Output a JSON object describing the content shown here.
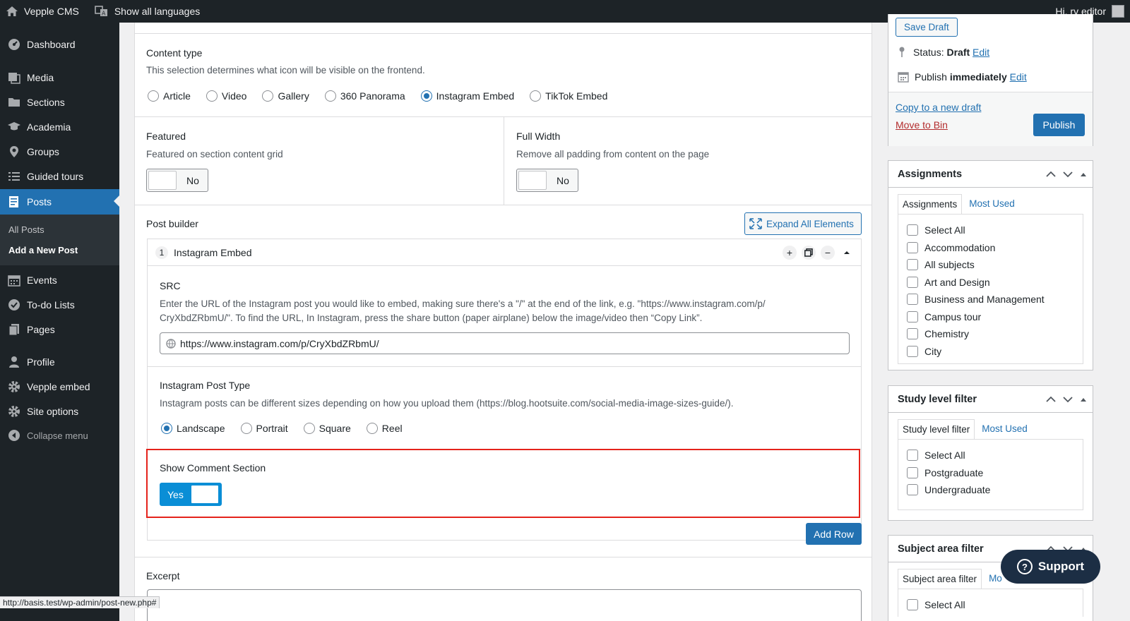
{
  "adminbar": {
    "site_name": "Vepple CMS",
    "languages": "Show all languages",
    "greeting": "Hi, rv editor"
  },
  "sidebar": {
    "items": [
      {
        "label": "Dashboard",
        "icon": "dashboard-icon"
      },
      {
        "label": "Media",
        "icon": "media-icon"
      },
      {
        "label": "Sections",
        "icon": "folder-icon"
      },
      {
        "label": "Academia",
        "icon": "graduation-cap-icon"
      },
      {
        "label": "Groups",
        "icon": "location-pin-icon"
      },
      {
        "label": "Guided tours",
        "icon": "list-icon"
      },
      {
        "label": "Posts",
        "icon": "posts-icon"
      },
      {
        "label": "Events",
        "icon": "calendar-icon"
      },
      {
        "label": "To-do Lists",
        "icon": "check-circle-icon"
      },
      {
        "label": "Pages",
        "icon": "pages-icon"
      },
      {
        "label": "Profile",
        "icon": "user-icon"
      },
      {
        "label": "Vepple embed",
        "icon": "gear-icon"
      },
      {
        "label": "Site options",
        "icon": "gear-icon"
      },
      {
        "label": "Collapse menu",
        "icon": "collapse-icon"
      }
    ],
    "submenu": [
      "All Posts",
      "Add a New Post"
    ]
  },
  "content_type": {
    "label": "Content type",
    "description": "This selection determines what icon will be visible on the frontend.",
    "options": [
      "Article",
      "Video",
      "Gallery",
      "360 Panorama",
      "Instagram Embed",
      "TikTok Embed"
    ],
    "selected": "Instagram Embed"
  },
  "featured": {
    "label": "Featured",
    "description": "Featured on section content grid",
    "value": "No"
  },
  "full_width": {
    "label": "Full Width",
    "description": "Remove all padding from content on the page",
    "value": "No"
  },
  "post_builder": {
    "label": "Post builder",
    "expand_label": "Expand All Elements",
    "element_number": "1",
    "element_title": "Instagram Embed",
    "src": {
      "label": "SRC",
      "description_1": "Enter the URL of the Instagram post you would like to embed, making sure there's a \"/\" at the end of the link, e.g. \"https://www.instagram.com/p/",
      "description_2": "CryXbdZRbmU/\". To find the URL, In Instagram, press the share button (paper airplane) below the image/video then “Copy Link”.",
      "value": "https://www.instagram.com/p/CryXbdZRbmU/"
    },
    "post_type": {
      "label": "Instagram Post Type",
      "description": "Instagram posts can be different sizes depending on how you upload them (https://blog.hootsuite.com/social-media-image-sizes-guide/).",
      "options": [
        "Landscape",
        "Portrait",
        "Square",
        "Reel"
      ],
      "selected": "Landscape"
    },
    "comments": {
      "label": "Show Comment Section",
      "value": "Yes"
    },
    "add_row_label": "Add Row"
  },
  "excerpt": {
    "label": "Excerpt"
  },
  "publish_box": {
    "save_draft": "Save Draft",
    "status_label": "Status:",
    "status_value": "Draft",
    "edit": "Edit",
    "publish_label": "Publish",
    "publish_value": "immediately",
    "copy_draft": "Copy to a new draft",
    "move_bin": "Move to Bin",
    "publish_button": "Publish"
  },
  "assignments": {
    "title": "Assignments",
    "tab_all": "Assignments",
    "tab_used": "Most Used",
    "items": [
      "Select All",
      "Accommodation",
      "All subjects",
      "Art and Design",
      "Business and Management",
      "Campus tour",
      "Chemistry",
      "City"
    ]
  },
  "study_level": {
    "title": "Study level filter",
    "tab_all": "Study level filter",
    "tab_used": "Most Used",
    "items": [
      "Select All",
      "Postgraduate",
      "Undergraduate"
    ]
  },
  "subject_area": {
    "title": "Subject area filter",
    "tab_all": "Subject area filter",
    "tab_used": "Mo",
    "items": [
      "Select All"
    ]
  },
  "support_label": "Support",
  "status_url": "http://basis.test/wp-admin/post-new.php#"
}
